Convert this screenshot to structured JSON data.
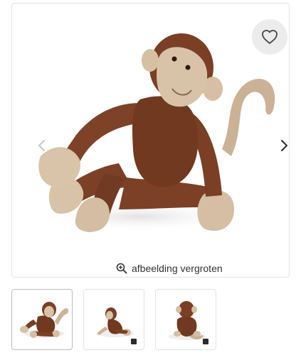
{
  "product_gallery": {
    "zoom_label": "afbeelding vergroten",
    "images": [
      "monkey-sitting",
      "monkey-side",
      "monkey-back"
    ],
    "selected_index": 0
  },
  "icons": {
    "favorite": "heart-outline-icon",
    "prev": "chevron-left-icon",
    "next": "chevron-right-icon",
    "zoom": "zoom-in-icon"
  },
  "colors": {
    "fur_dark": "#7a3f25",
    "fur_light": "#d7c0a6",
    "fav_bg": "#ececec"
  }
}
